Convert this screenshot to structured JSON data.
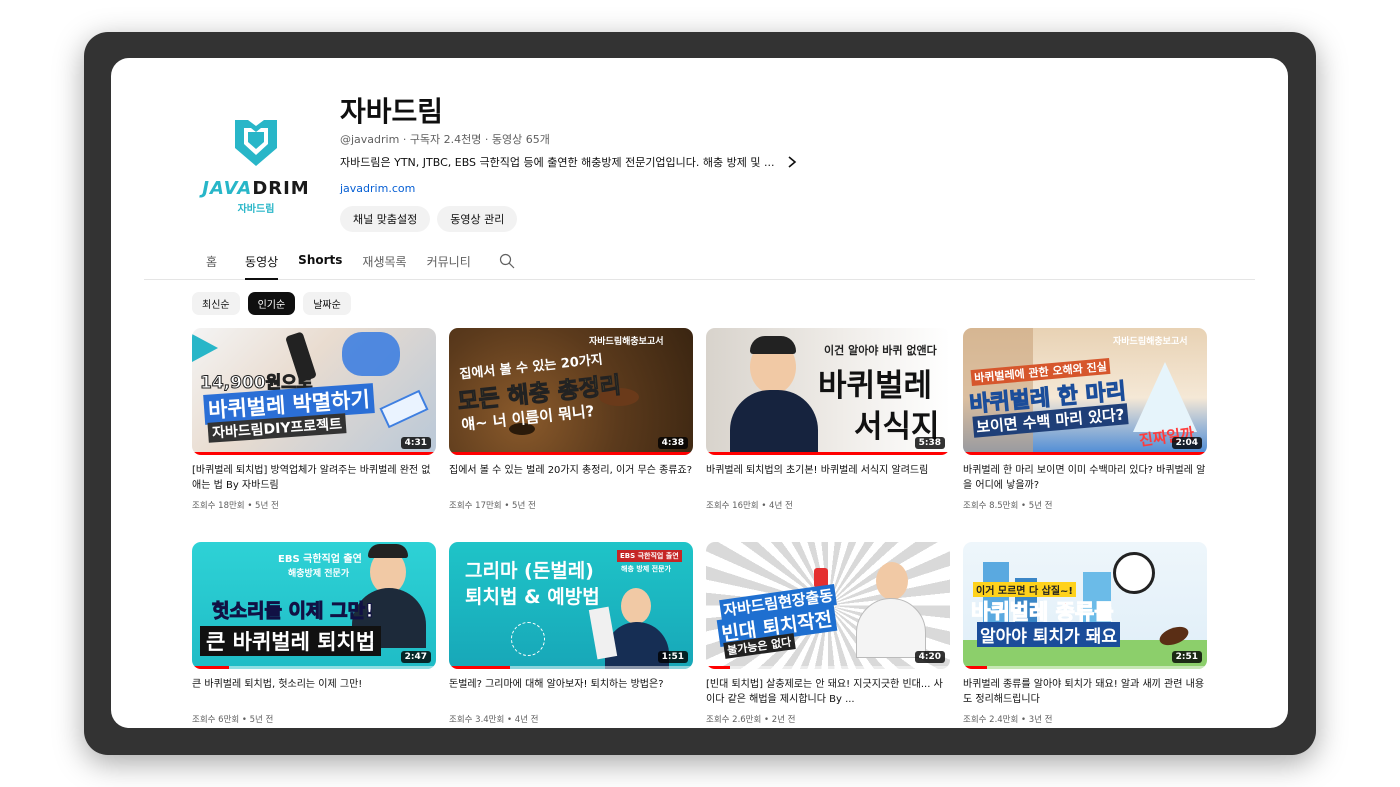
{
  "channel": {
    "name": "자바드림",
    "meta": "@javadrim · 구독자 2.4천명 · 동영상 65개",
    "description": "자바드림은 YTN, JTBC, EBS 극한직업 등에 출연한 해충방제 전문기업입니다. 해충 방제 및 ...",
    "link": "javadrim.com",
    "logo_word_a": "JAVA",
    "logo_word_b": "DRIM",
    "logo_sub": "자바드림",
    "buttons": [
      "채널 맞춤설정",
      "동영상 관리"
    ]
  },
  "tabs": [
    "홈",
    "동영상",
    "Shorts",
    "재생목록",
    "커뮤니티"
  ],
  "active_tab": "동영상",
  "chips": [
    "최신순",
    "인기순",
    "날짜순"
  ],
  "active_chip": "인기순",
  "videos": [
    {
      "title": "[바퀴벌레 퇴치법] 방역업체가 알려주는 바퀴벌레 완전 없애는 법 By 자바드림",
      "meta": "조회수 18만회 • 5년 전",
      "duration": "4:31",
      "progress": 1.0,
      "thumb_text": [
        "14,900원으로",
        "바퀴벌레 박멸하기",
        "자바드림DIY프로젝트"
      ]
    },
    {
      "title": "집에서 볼 수 있는 벌레 20가지 총정리, 이거 무슨 종류죠?",
      "meta": "조회수 17만회 • 5년 전",
      "duration": "4:38",
      "progress": 1.0,
      "thumb_text": [
        "자바드림해충보고서",
        "집에서 볼 수 있는 20가지",
        "모든 해충 총정리",
        "얘~ 너 이름이 뭐니?"
      ]
    },
    {
      "title": "바퀴벌레 퇴치법의 초기본! 바퀴벌레 서식지 알려드림",
      "meta": "조회수 16만회 • 4년 전",
      "duration": "5:38",
      "progress": 1.0,
      "thumb_text": [
        "이건 알아야 바퀴 없앤다",
        "바퀴벌레",
        "서식지"
      ]
    },
    {
      "title": "바퀴벌레 한 마리 보이면 이미 수백마리 있다? 바퀴벌레 알을 어디에 낳을까?",
      "meta": "조회수 8.5만회 • 5년 전",
      "duration": "2:04",
      "progress": 1.0,
      "thumb_text": [
        "자바드림해충보고서",
        "바퀴벌레에 관한 오해와 진실",
        "바퀴벌레 한 마리",
        "보이면 수백 마리 있다?",
        "진짜일까"
      ]
    },
    {
      "title": "큰 바퀴벌레 퇴치법, 헛소리는 이제 그만!",
      "meta": "조회수 6만회 • 5년 전",
      "duration": "2:47",
      "progress": 0.15,
      "thumb_text": [
        "EBS 극한직업 출연",
        "해충방제 전문가",
        "헛소리들 이제 그만!",
        "큰 바퀴벌레 퇴치법"
      ]
    },
    {
      "title": "돈벌레? 그리마에 대해 알아보자! 퇴치하는 방법은?",
      "meta": "조회수 3.4만회 • 4년 전",
      "duration": "1:51",
      "progress": 0.25,
      "thumb_text": [
        "그리마 (돈벌레)",
        "퇴치법 & 예방법",
        "EBS 극한직업 출연",
        "해충 방제 전문가"
      ]
    },
    {
      "title": "[빈대 퇴치법] 살충제로는 안 돼요! 지긋지긋한 빈대... 사이다 같은 해법을 제시합니다 By ...",
      "meta": "조회수 2.6만회 • 2년 전",
      "duration": "4:20",
      "progress": 0.1,
      "thumb_text": [
        "자바드림현장출동",
        "빈대 퇴치작전",
        "불가능은 없다"
      ]
    },
    {
      "title": "바퀴벌레 종류를 알아야 퇴치가 돼요! 알과 새끼 관련 내용도 정리해드립니다",
      "meta": "조회수 2.4만회 • 3년 전",
      "duration": "2:51",
      "progress": 0.1,
      "thumb_text": [
        "이거 모르면 다 삽질~!",
        "바퀴벌레 종류를",
        "알아야 퇴치가 돼요"
      ]
    }
  ],
  "colors": {
    "accent": "#28b6c8",
    "progress": "#ff0000",
    "link": "#065fd4"
  }
}
